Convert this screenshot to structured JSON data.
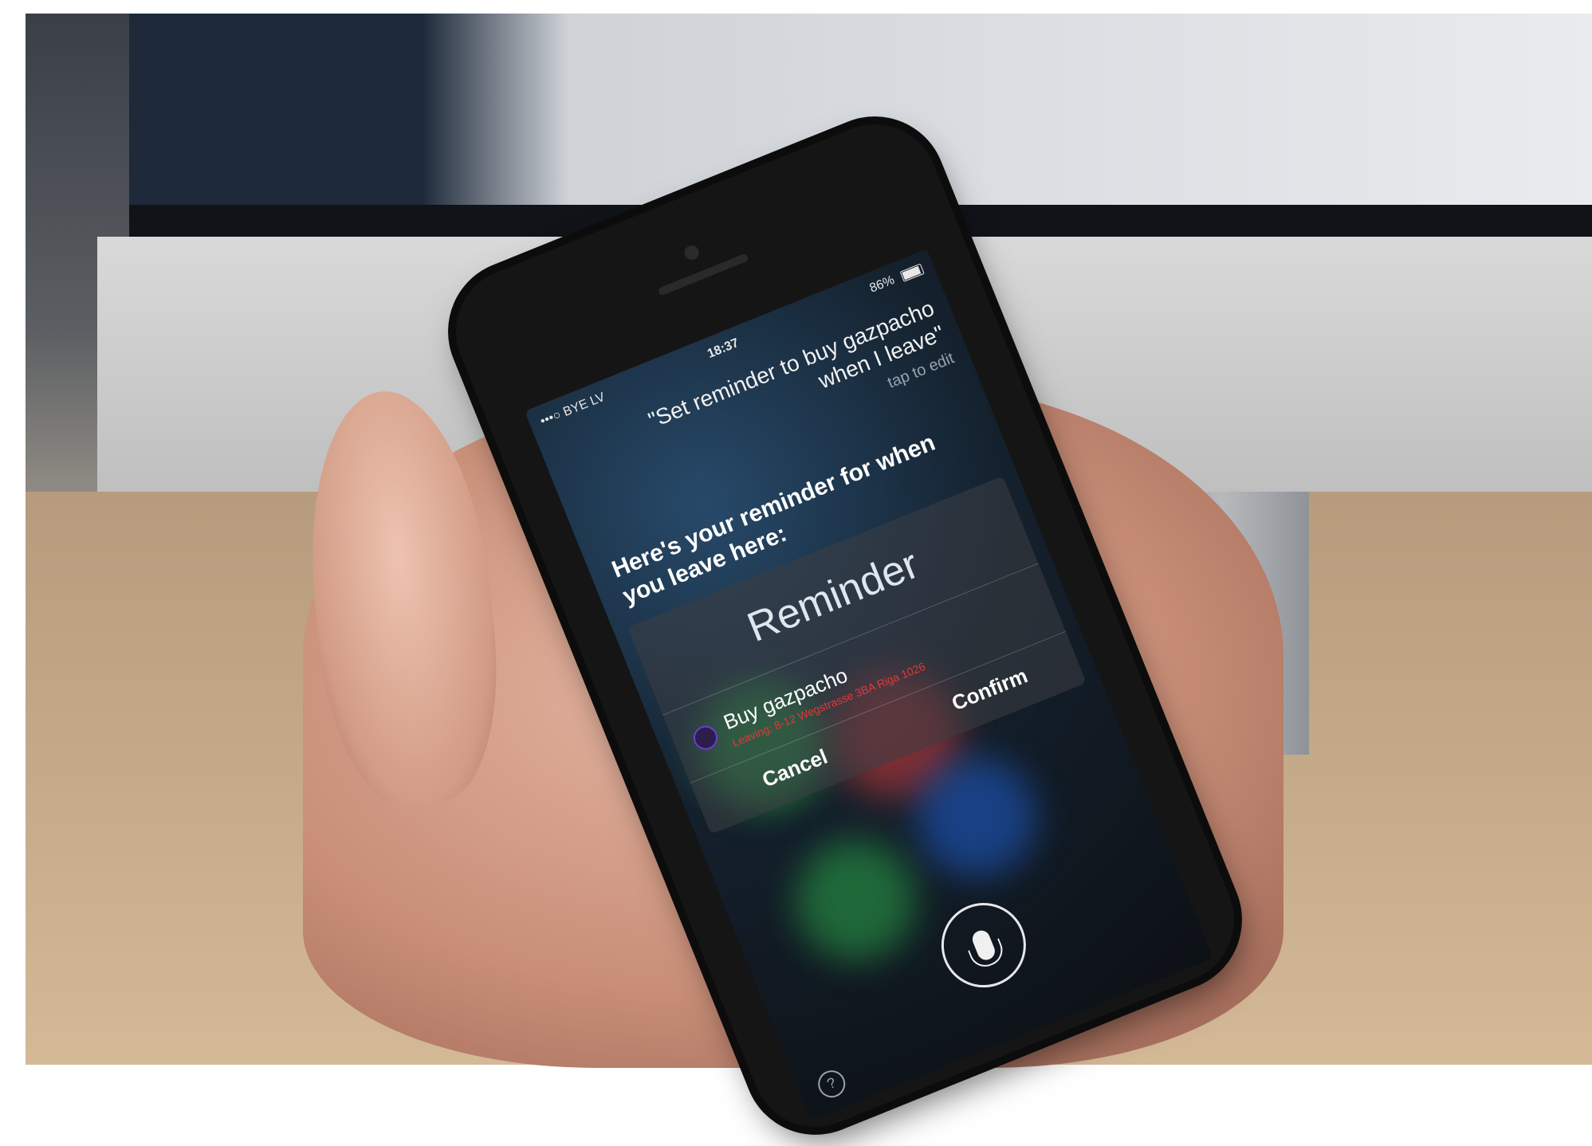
{
  "status": {
    "carrier": "•••○ BYE LV",
    "time": "18:37",
    "battery": "86%"
  },
  "siri": {
    "query": "\"Set reminder to buy gazpacho when I leave\"",
    "tap_to_edit": "tap to edit",
    "response": "Here's your reminder for when you leave here:"
  },
  "reminder_card": {
    "title": "Reminder",
    "item_title": "Buy gazpacho",
    "item_subtitle": "Leaving: 8-12 Wegstrasse 3BA Riga 1026",
    "cancel_label": "Cancel",
    "confirm_label": "Confirm"
  },
  "icons": {
    "apple_logo": "apple-logo",
    "mic": "microphone-icon",
    "help": "help-icon",
    "battery": "battery-icon"
  },
  "colors": {
    "reminder_checkbox": "#6f3bd0",
    "subtitle_red": "#e0383b"
  }
}
